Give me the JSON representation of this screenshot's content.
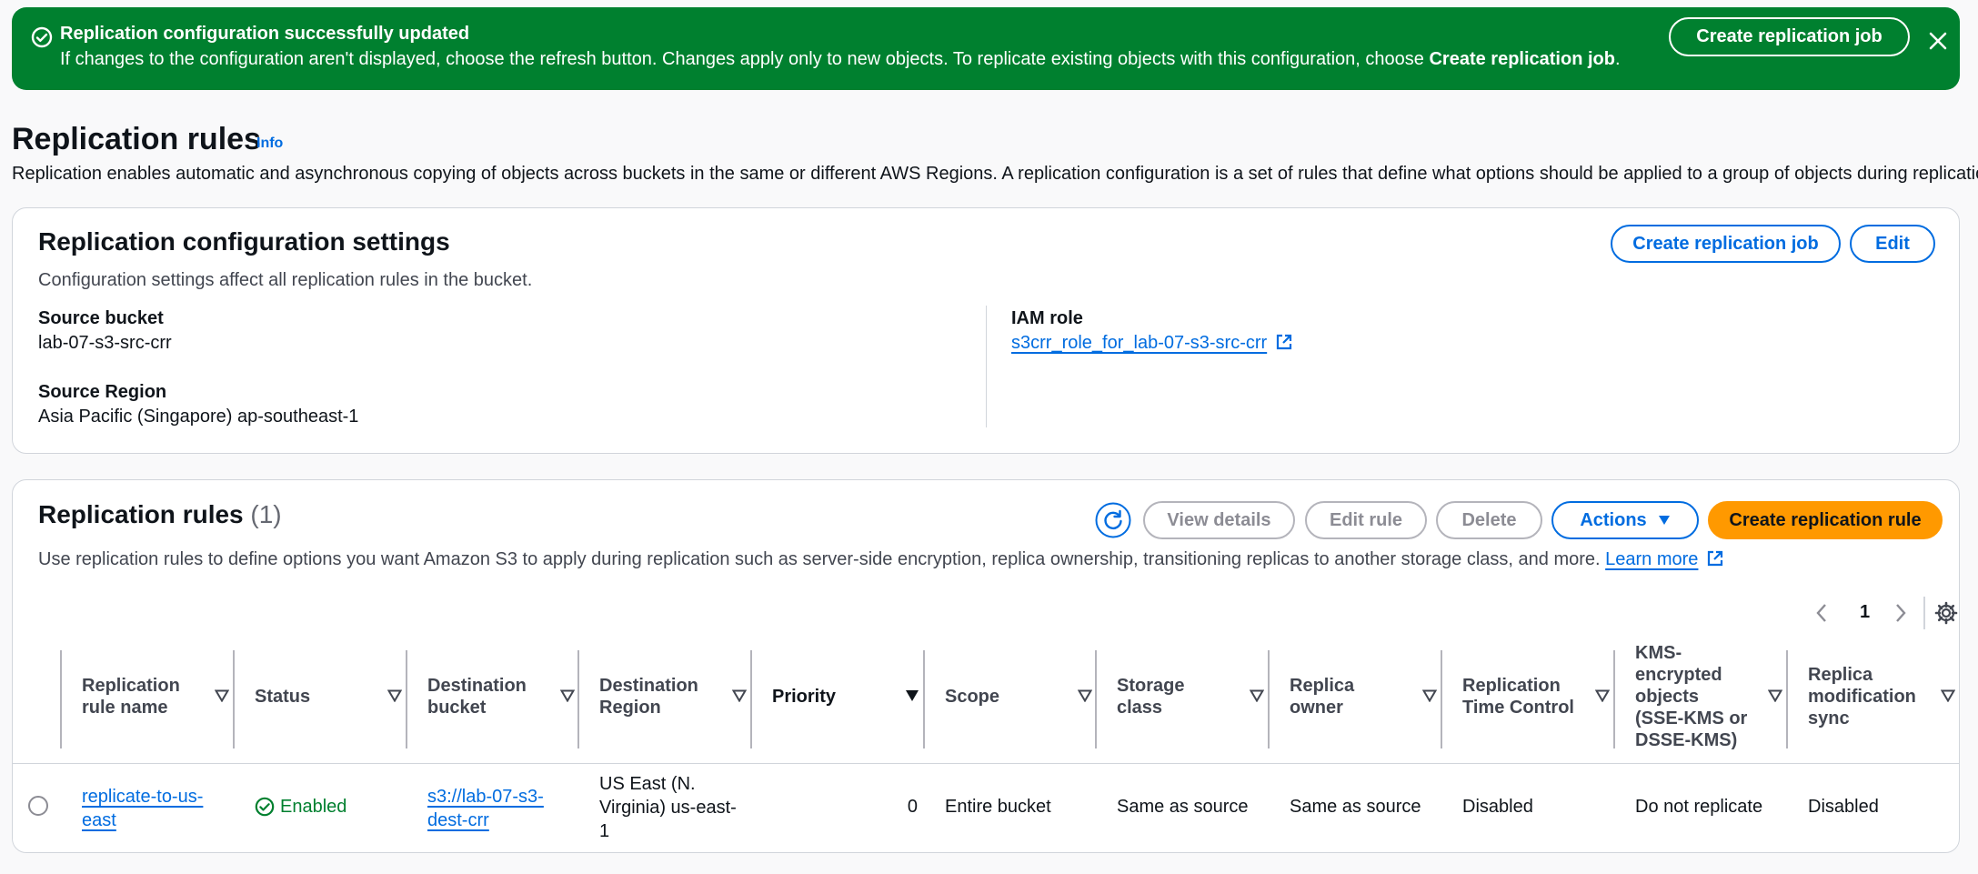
{
  "flash": {
    "title": "Replication configuration successfully updated",
    "message_prefix": "If changes to the configuration aren't displayed, choose the refresh button. Changes apply only to new objects. To replicate existing objects with this configuration, choose ",
    "message_bold": "Create replication job",
    "message_suffix": ".",
    "button": "Create replication job",
    "icons": {
      "status": "check-circle-icon",
      "dismiss": "close-icon"
    },
    "color": "#00802f"
  },
  "page": {
    "title": "Replication rules",
    "info": "Info",
    "description": "Replication enables automatic and asynchronous copying of objects across buckets in the same or different AWS Regions. A replication configuration is a set of rules that define what options should be applied to a group of objects during replication."
  },
  "config": {
    "title": "Replication configuration settings",
    "description": "Configuration settings affect all replication rules in the bucket.",
    "buttons": {
      "create_job": "Create replication job",
      "edit": "Edit"
    },
    "source_bucket_label": "Source bucket",
    "source_bucket": "lab-07-s3-src-crr",
    "source_region_label": "Source Region",
    "source_region": "Asia Pacific (Singapore) ap-southeast-1",
    "iam_role_label": "IAM role",
    "iam_role": "s3crr_role_for_lab-07-s3-src-crr"
  },
  "rules": {
    "title": "Replication rules",
    "count": "(1)",
    "description": "Use replication rules to define options you want Amazon S3 to apply during replication such as server-side encryption, replica ownership, transitioning replicas to another storage class, and more.",
    "learn_more": "Learn more",
    "buttons": {
      "view_details": "View details",
      "edit_rule": "Edit rule",
      "delete": "Delete",
      "actions": "Actions",
      "create_rule": "Create replication rule"
    },
    "pagination": {
      "current_page": "1"
    },
    "columns": [
      "Replication rule name",
      "Status",
      "Destination bucket",
      "Destination Region",
      "Priority",
      "Scope",
      "Storage class",
      "Replica owner",
      "Replication Time Control",
      "KMS-encrypted objects (SSE-KMS or DSSE-KMS)",
      "Replica modification sync"
    ],
    "rows": [
      {
        "name": "replicate-to-us-east",
        "status": "Enabled",
        "destination_bucket": "s3://lab-07-s3-dest-crr",
        "destination_region": "US East (N. Virginia) us-east-1",
        "priority": "0",
        "scope": "Entire bucket",
        "storage_class": "Same as source",
        "replica_owner": "Same as source",
        "rtc": "Disabled",
        "kms": "Do not replicate",
        "replica_mod_sync": "Disabled"
      }
    ]
  },
  "colors": {
    "link": "#006ce0",
    "primary": "#ff9900",
    "success": "#00802f"
  }
}
